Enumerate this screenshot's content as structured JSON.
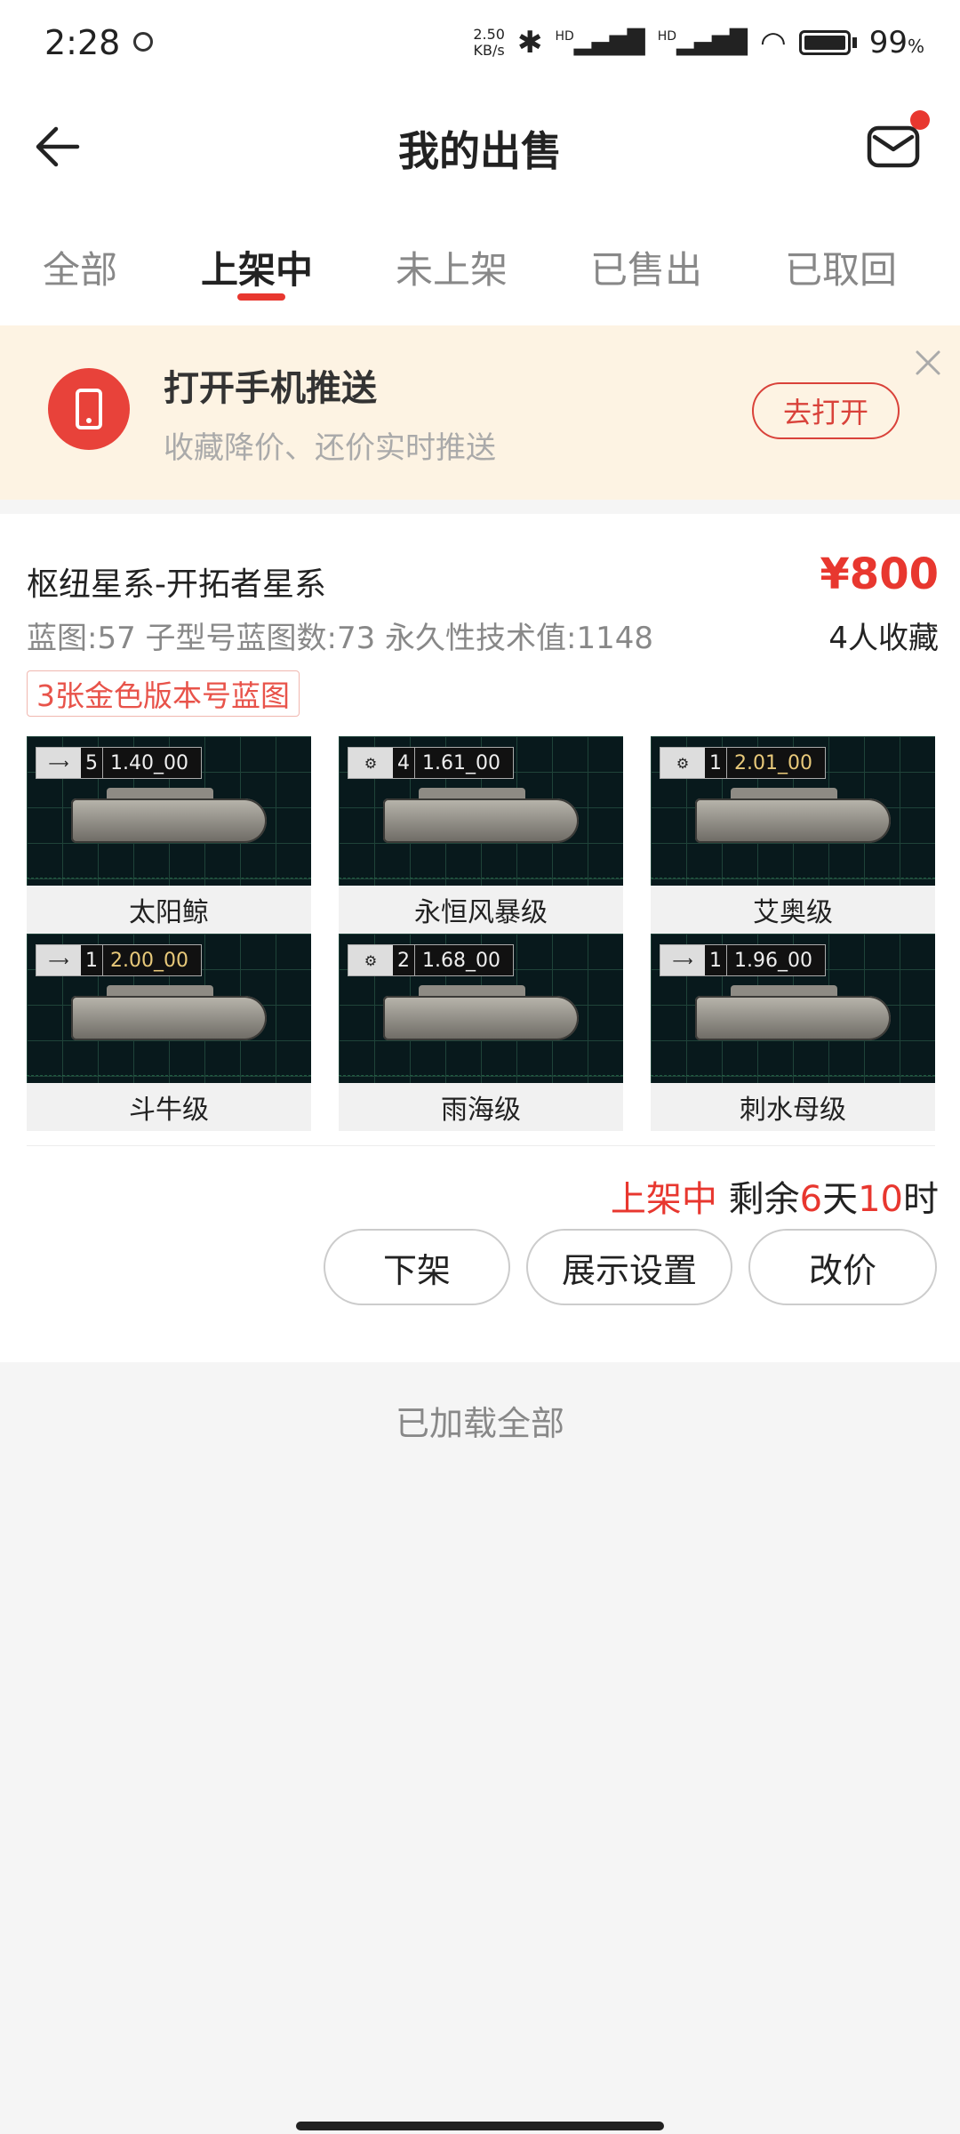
{
  "status_bar": {
    "time": "2:28",
    "net_speed_value": "2.50",
    "net_speed_unit": "KB/s",
    "signal_1": "HD",
    "signal_2": "HD",
    "battery": "99",
    "battery_unit": "%"
  },
  "header": {
    "title": "我的出售"
  },
  "tabs": [
    {
      "label": "全部",
      "active": false
    },
    {
      "label": "上架中",
      "active": true
    },
    {
      "label": "未上架",
      "active": false
    },
    {
      "label": "已售出",
      "active": false
    },
    {
      "label": "已取回",
      "active": false
    }
  ],
  "banner": {
    "title": "打开手机推送",
    "subtitle": "收藏降价、还价实时推送",
    "open_button": "去打开"
  },
  "listing": {
    "title": "枢纽星系-开拓者星系",
    "price": "¥800",
    "meta": "蓝图:57 子型号蓝图数:73 永久性技术值:1148",
    "favorites": "4人收藏",
    "badge": "3张金色版本号蓝图",
    "ships": [
      {
        "name": "太阳鲸",
        "count": "5",
        "version": "1.40_00"
      },
      {
        "name": "永恒风暴级",
        "count": "4",
        "version": "1.61_00"
      },
      {
        "name": "艾奥级",
        "count": "1",
        "version": "2.01_00"
      },
      {
        "name": "斗牛级",
        "count": "1",
        "version": "2.00_00"
      },
      {
        "name": "雨海级",
        "count": "2",
        "version": "1.68_00"
      },
      {
        "name": "刺水母级",
        "count": "1",
        "version": "1.96_00"
      }
    ],
    "status_label": "上架中",
    "remaining_prefix": "剩余",
    "remaining_days": "6",
    "days_unit": "天",
    "remaining_hours": "10",
    "hours_unit": "时",
    "buttons": {
      "delist": "下架",
      "display_settings": "展示设置",
      "change_price": "改价"
    }
  },
  "footer": {
    "loaded_all": "已加载全部"
  },
  "colors": {
    "accent": "#e8372f",
    "banner_bg": "#fdf3e3",
    "page_bg": "#f5f5f5"
  }
}
